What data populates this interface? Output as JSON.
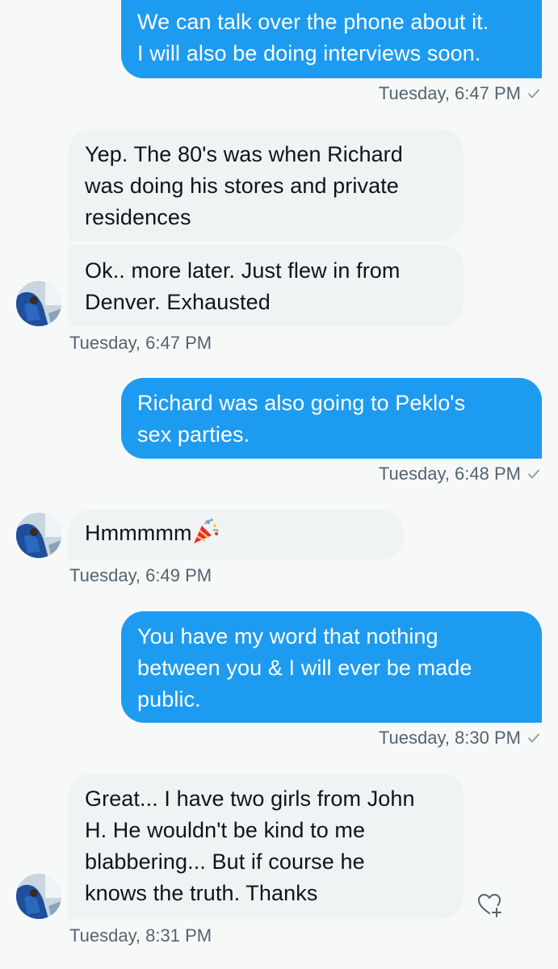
{
  "conversation": {
    "messages": [
      {
        "direction": "outgoing",
        "lines": [
          "We can talk over the phone about it.",
          "I will also be doing interviews soon."
        ],
        "timestamp": "Tuesday, 6:47 PM",
        "read_receipt": "check-icon"
      },
      {
        "direction": "incoming",
        "lines": [
          "Yep.  The 80's was when Richard",
          "was doing his stores and private",
          "residences"
        ]
      },
      {
        "direction": "incoming",
        "lines": [
          "Ok.. more later. Just flew in from",
          "Denver. Exhausted"
        ],
        "timestamp": "Tuesday, 6:47 PM"
      },
      {
        "direction": "outgoing",
        "lines": [
          "Richard was also going to Peklo's",
          "sex parties."
        ],
        "timestamp": "Tuesday, 6:48 PM",
        "read_receipt": "check-icon"
      },
      {
        "direction": "incoming",
        "lines": [
          "Hmmmmm"
        ],
        "emoji": "party-popper-icon",
        "timestamp": "Tuesday, 6:49 PM"
      },
      {
        "direction": "outgoing",
        "lines": [
          "You have my word that nothing",
          "between you & I will ever be made",
          "public."
        ],
        "timestamp": "Tuesday, 8:30 PM",
        "read_receipt": "check-icon"
      },
      {
        "direction": "incoming",
        "lines": [
          "Great... I have two girls from John",
          "H.   He wouldn't be kind to me",
          "blabbering... But if course he",
          "knows the truth. Thanks"
        ],
        "timestamp": "Tuesday, 8:31 PM",
        "reaction_button": "add-reaction-heart-icon"
      }
    ]
  },
  "colors": {
    "outgoing_bubble": "#1d9bf0",
    "incoming_bubble": "#eff3f4",
    "timestamp_text": "#536471",
    "background": "#f7f9f9"
  }
}
